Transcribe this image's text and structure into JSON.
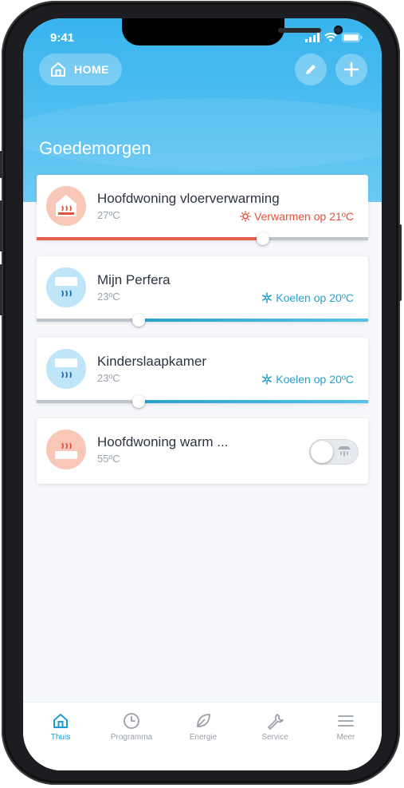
{
  "status_bar": {
    "time": "9:41"
  },
  "header": {
    "home_label": "HOME",
    "greeting": "Goedemorgen"
  },
  "devices": [
    {
      "name": "Hoofdwoning vloerverwarming",
      "temp": "27ºC",
      "mode": "Verwarmen op 21ºC",
      "mode_type": "heat",
      "setpoint_fraction": 0.68
    },
    {
      "name": "Mijn Perfera",
      "temp": "23ºC",
      "mode": "Koelen op 20ºC",
      "mode_type": "cool",
      "setpoint_fraction": 0.31
    },
    {
      "name": "Kinderslaapkamer",
      "temp": "23ºC",
      "mode": "Koelen op 20ºC",
      "mode_type": "cool",
      "setpoint_fraction": 0.31
    },
    {
      "name": "Hoofdwoning warm ...",
      "temp": "55ºC",
      "toggle_on": false
    }
  ],
  "tabs": [
    {
      "label": "Thuis",
      "icon": "home-icon",
      "active": true
    },
    {
      "label": "Programma",
      "icon": "clock-icon",
      "active": false
    },
    {
      "label": "Energie",
      "icon": "leaf-icon",
      "active": false
    },
    {
      "label": "Service",
      "icon": "wrench-icon",
      "active": false
    },
    {
      "label": "Meer",
      "icon": "menu-icon",
      "active": false
    }
  ],
  "colors": {
    "accent": "#1d9bd7",
    "heat": "#e2513a",
    "cool": "#2aa1cc",
    "hero": "#38b4ee"
  }
}
